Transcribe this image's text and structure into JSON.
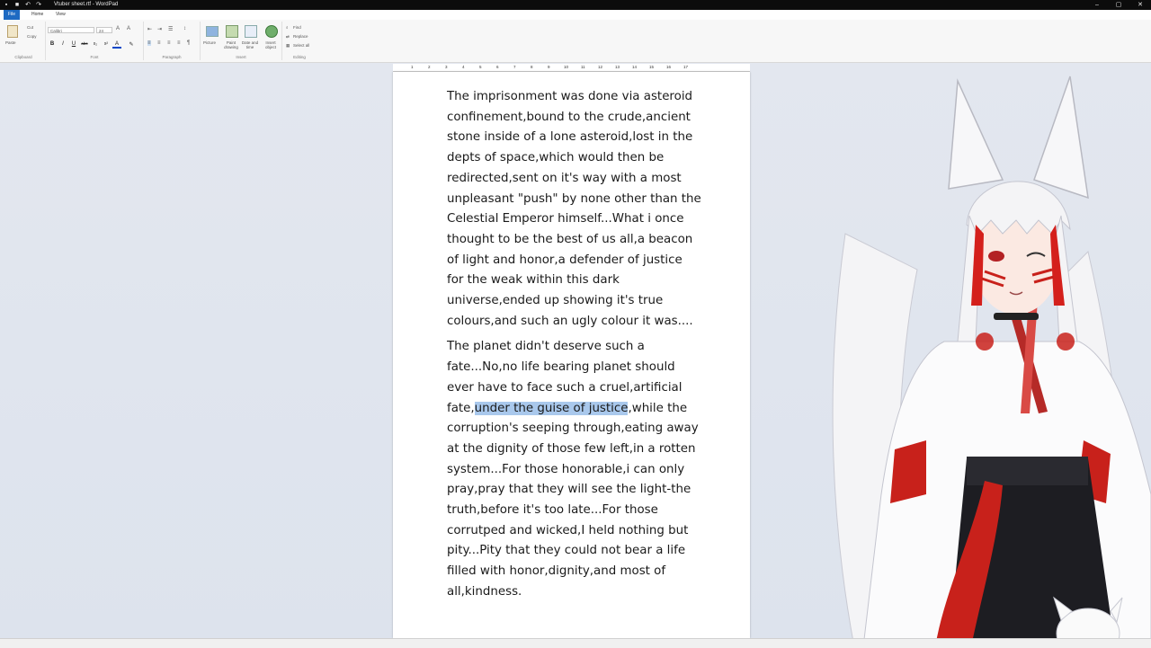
{
  "window": {
    "title": "Vtuber sheet.rtf - WordPad",
    "minimize": "–",
    "maximize": "▢",
    "close": "✕"
  },
  "quick_access": [
    "■",
    "↶",
    "↷"
  ],
  "menu": {
    "file": "File",
    "home": "Home",
    "view": "View"
  },
  "ribbon": {
    "clipboard": {
      "paste": "Paste",
      "cut": "Cut",
      "copy": "Copy",
      "label": "Clipboard"
    },
    "font": {
      "family": "Calibri",
      "size": "24",
      "label": "Font",
      "bold": "B",
      "italic": "I",
      "underline": "U",
      "strike": "abc",
      "sub": "x₂",
      "sup": "x²",
      "color": "A"
    },
    "paragraph": {
      "label": "Paragraph"
    },
    "insert": {
      "picture": "Picture",
      "paint": "Paint drawing",
      "datetime": "Date and time",
      "object": "Insert object",
      "label": "Insert"
    },
    "editing": {
      "find": "Find",
      "replace": "Replace",
      "select_all": "Select all",
      "label": "Editing"
    }
  },
  "ruler": [
    "1",
    "2",
    "3",
    "4",
    "5",
    "6",
    "7",
    "8",
    "9",
    "10",
    "11",
    "12",
    "13",
    "14",
    "15",
    "16",
    "17"
  ],
  "document": {
    "para1": "The imprisonment was done via asteroid confinement,bound to the crude,ancient stone inside of a lone asteroid,lost in the depts of space,which would then be redirected,sent on it's way with a most unpleasant \"push\" by none other than the Celestial Emperor himself...What i once thought to be the best of us all,a beacon of light and honor,a defender of justice for the weak within this dark universe,ended up showing it's true colours,and such an ugly colour it was....",
    "para2_before": "The planet didn't deserve such a fate...No,no life bearing planet should ever have to face such a cruel,artificial fate,",
    "para2_selected": "under the guise of justice",
    "para2_after": ",while the corruption's seeping through,eating away at the dignity of those few left,in a rotten system...For those honorable,i can only pray,pray that they will see the light-the truth,before it's too late...For those corrutped and wicked,I held nothing but pity...Pity that they could not bear a life filled with honor,dignity,and most of all,kindness."
  },
  "colors": {
    "selection": "#a9c8ec",
    "file_tab": "#1e6ac2",
    "hair_red": "#d4201c"
  }
}
